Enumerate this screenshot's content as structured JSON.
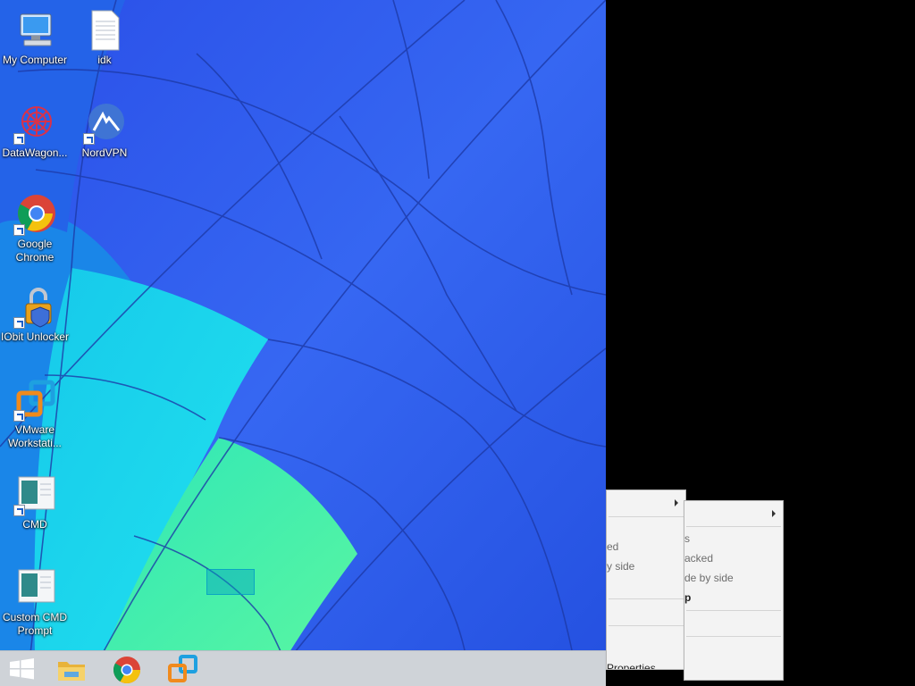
{
  "desktop": {
    "icons": [
      {
        "label": "My Computer",
        "icon": "computer-icon",
        "shortcut": false
      },
      {
        "label": "idk",
        "icon": "text-file-icon",
        "shortcut": false
      },
      {
        "label": "DataWagon...",
        "icon": "datawagon-icon",
        "shortcut": true
      },
      {
        "label": "NordVPN",
        "icon": "nordvpn-icon",
        "shortcut": true
      },
      {
        "label": "Google Chrome",
        "icon": "chrome-icon",
        "shortcut": true
      },
      {
        "label": "IObit Unlocker",
        "icon": "lock-icon",
        "shortcut": true
      },
      {
        "label": "VMware Workstati...",
        "icon": "vmware-icon",
        "shortcut": true
      },
      {
        "label": "CMD",
        "icon": "cmd-icon",
        "shortcut": true
      },
      {
        "label": "Custom CMD Prompt",
        "icon": "cmd-icon",
        "shortcut": false
      }
    ]
  },
  "taskbar": {
    "items": [
      {
        "name": "start-button",
        "icon": "windows-logo-icon"
      },
      {
        "name": "file-explorer-button",
        "icon": "folder-icon"
      },
      {
        "name": "chrome-taskbar-button",
        "icon": "chrome-icon"
      },
      {
        "name": "vmware-taskbar-button",
        "icon": "vmware-icon"
      }
    ]
  },
  "context_menu_back": {
    "items": [
      {
        "text": "ed",
        "state": "disabled"
      },
      {
        "text": "y side",
        "state": "disabled"
      },
      {
        "text": "Properties",
        "state": "normal"
      }
    ]
  },
  "context_menu_front": {
    "items": [
      {
        "text": "s",
        "state": "disabled"
      },
      {
        "text": "acked",
        "state": "disabled"
      },
      {
        "text": "de by side",
        "state": "disabled"
      },
      {
        "text": "p",
        "state": "bold"
      }
    ]
  },
  "colors": {
    "wallpaper_blue": "#2f5ef0",
    "wallpaper_cyan": "#1ad8ea",
    "wallpaper_green": "#3ff5a6",
    "taskbar": "#cfd3d8",
    "menu_bg": "#f3f3f3"
  }
}
